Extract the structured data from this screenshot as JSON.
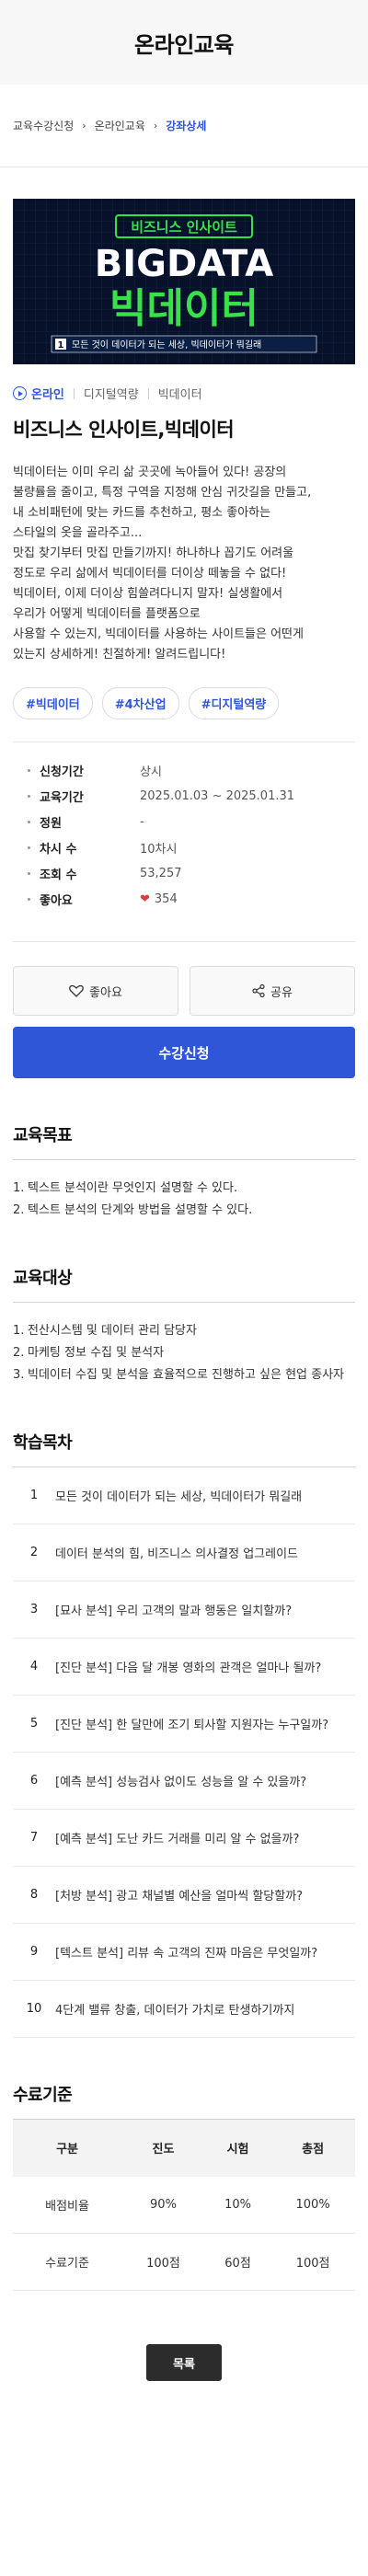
{
  "page_title": "온라인교육",
  "breadcrumb": [
    "교육수강신청",
    "온라인교육",
    "강좌상세"
  ],
  "banner": {
    "top_text": "비즈니스 인사이트",
    "big_text": "BIGDATA",
    "kor_text": "빅데이터",
    "caption_num": "1",
    "caption": "모든 것이 데이터가 되는 세상, 빅데이터가 뭐길래"
  },
  "meta": {
    "mode": "온라인",
    "category1": "디지털역량",
    "category2": "빅데이터"
  },
  "course_title": "비즈니스 인사이트,빅데이터",
  "description": [
    "빅데이터는 이미 우리 삶 곳곳에 녹아들어 있다! 공장의",
    "불량률을 줄이고, 특정 구역을 지정해 안심 귀갓길을 만들고,",
    "내 소비패턴에 맞는 카드를 추천하고, 평소 좋아하는",
    "스타일의 옷을 골라주고...",
    "맛집 찾기부터 맛집 만들기까지! 하나하나 꼽기도 어려울",
    "정도로 우리 삶에서 빅데이터를 더이상 떼놓을 수 없다!",
    "빅데이터, 이제 더이상 힘쓸려다니지 말자! 실생활에서",
    "우리가 어떻게 빅데이터를 플랫폼으로",
    "사용할 수 있는지, 빅데이터를 사용하는 사이트들은 어떤게",
    "있는지 상세하게! 친절하게! 알려드립니다!"
  ],
  "tags": [
    "#빅데이터",
    "#4차산업",
    "#디지털역량"
  ],
  "info": [
    {
      "label": "신청기간",
      "value": "상시"
    },
    {
      "label": "교육기간",
      "value": "2025.01.03 ~ 2025.01.31"
    },
    {
      "label": "정원",
      "value": "-"
    },
    {
      "label": "차시 수",
      "value": "10차시"
    },
    {
      "label": "조회 수",
      "value": "53,257"
    },
    {
      "label": "좋아요",
      "value": "354"
    }
  ],
  "actions": {
    "like": "좋아요",
    "share": "공유",
    "enroll": "수강신청"
  },
  "goals": {
    "title": "교육목표",
    "items": [
      "텍스트 분석이란 무엇인지 설명할 수 있다.",
      "텍스트 분석의 단계와 방법을 설명할 수 있다."
    ]
  },
  "targets": {
    "title": "교육대상",
    "items": [
      "전산시스템 및 데이터 관리 담당자",
      "마케팅 정보 수집 및 분석자",
      "빅데이터 수집 및 분석을 효율적으로 진행하고 싶은 현업 종사자"
    ]
  },
  "curriculum": {
    "title": "학습목차",
    "items": [
      "모든 것이 데이터가 되는 세상, 빅데이터가 뭐길래",
      "데이터 분석의 힘, 비즈니스 의사결정 업그레이드",
      "[묘사 분석] 우리 고객의 말과 행동은 일치할까?",
      "[진단 분석] 다음 달 개봉 영화의 관객은 얼마나 될까?",
      "[진단 분석] 한 달만에 조기 퇴사할 지원자는 누구일까?",
      "[예측 분석] 성능검사 없이도 성능을 알 수 있을까?",
      "[예측 분석] 도난 카드 거래를 미리 알 수 없을까?",
      "[처방 분석] 광고 채널별 예산을 얼마씩 할당할까?",
      "[텍스트 분석] 리뷰 속 고객의 진짜 마음은 무엇일까?",
      "4단계 밸류 창출, 데이터가 가치로 탄생하기까지"
    ]
  },
  "completion": {
    "title": "수료기준",
    "headers": [
      "구분",
      "진도",
      "시험",
      "총점"
    ],
    "rows": [
      [
        "배점비율",
        "90%",
        "10%",
        "100%"
      ],
      [
        "수료기준",
        "100점",
        "60점",
        "100점"
      ]
    ]
  },
  "list_button": "목록",
  "colors": {
    "accent": "#2e56d6",
    "heart": "#e03b3b",
    "banner_bg": "#07122a",
    "banner_green": "#39e04a"
  }
}
